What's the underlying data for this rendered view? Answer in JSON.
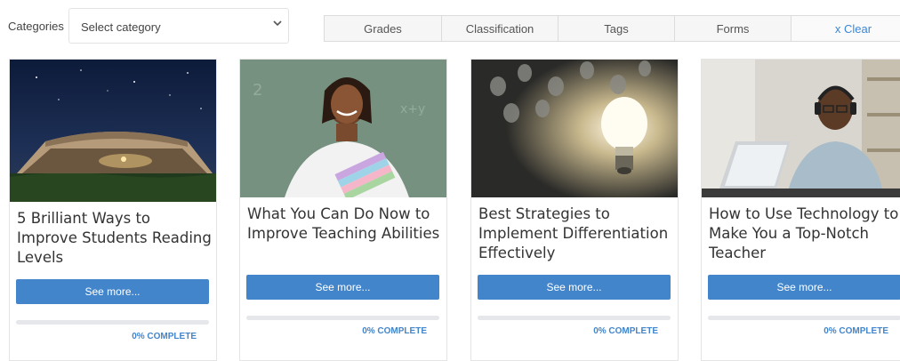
{
  "filters": {
    "categories_label": "Categories",
    "category_select_value": "Select category",
    "tabs": [
      "Grades",
      "Classification",
      "Tags",
      "Forms"
    ],
    "clear_label": "x Clear"
  },
  "cards": [
    {
      "title": "5 Brilliant Ways to Improve Students Reading Levels",
      "image": "book-tent-night-image",
      "button_label": "See more...",
      "progress_percent": 0,
      "progress_label": "0% COMPLETE"
    },
    {
      "title": "What You Can Do Now to Improve Teaching Abilities",
      "image": "teacher-holding-books-image",
      "button_label": "See more...",
      "progress_percent": 0,
      "progress_label": "0% COMPLETE"
    },
    {
      "title": "Best Strategies to Implement Differentiation Effectively",
      "image": "glowing-lightbulb-image",
      "button_label": "See more...",
      "progress_percent": 0,
      "progress_label": "0% COMPLETE"
    },
    {
      "title": "How to Use Technology to Make You a Top-Notch Teacher",
      "image": "man-with-headphones-laptop-image",
      "button_label": "See more...",
      "progress_percent": 0,
      "progress_label": "0% COMPLETE"
    }
  ],
  "colors": {
    "accent": "#4285cb",
    "clear_link": "#3a86d6",
    "progress_track": "#e6e7ea"
  }
}
